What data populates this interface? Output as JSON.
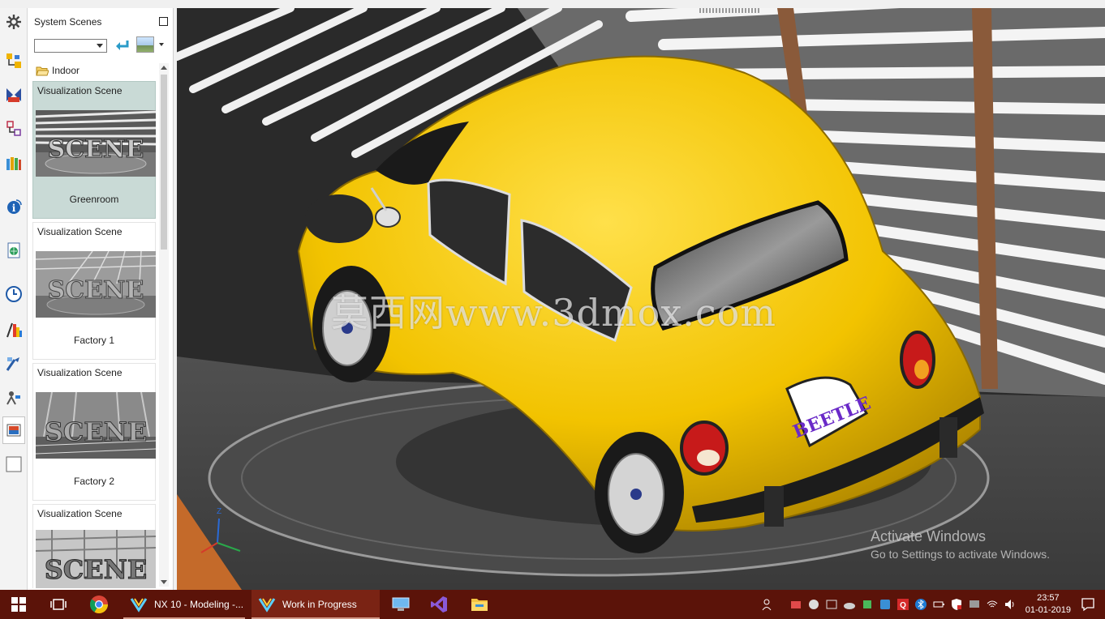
{
  "panel": {
    "title": "System Scenes",
    "selected_scene": "",
    "folder": "Indoor",
    "scenes": [
      {
        "category": "Visualization Scene",
        "name": "Greenroom",
        "selected": true
      },
      {
        "category": "Visualization Scene",
        "name": "Factory 1",
        "selected": false
      },
      {
        "category": "Visualization Scene",
        "name": "Factory 2",
        "selected": false
      },
      {
        "category": "Visualization Scene",
        "name": "",
        "selected": false
      }
    ],
    "thumb_text": "SCENE"
  },
  "viewport": {
    "watermark": "莫西网www.3dmox.com",
    "plate_text": "BEETLE",
    "triad_z": "Z",
    "activation_title": "Activate Windows",
    "activation_subtitle": "Go to Settings to activate Windows.",
    "car_color": "#f2c300"
  },
  "taskbar": {
    "apps": [
      {
        "label": "NX 10 - Modeling -..."
      },
      {
        "label": "Work in Progress"
      }
    ],
    "time": "23:57",
    "date": "01-01-2019",
    "background": "#5b1309"
  }
}
